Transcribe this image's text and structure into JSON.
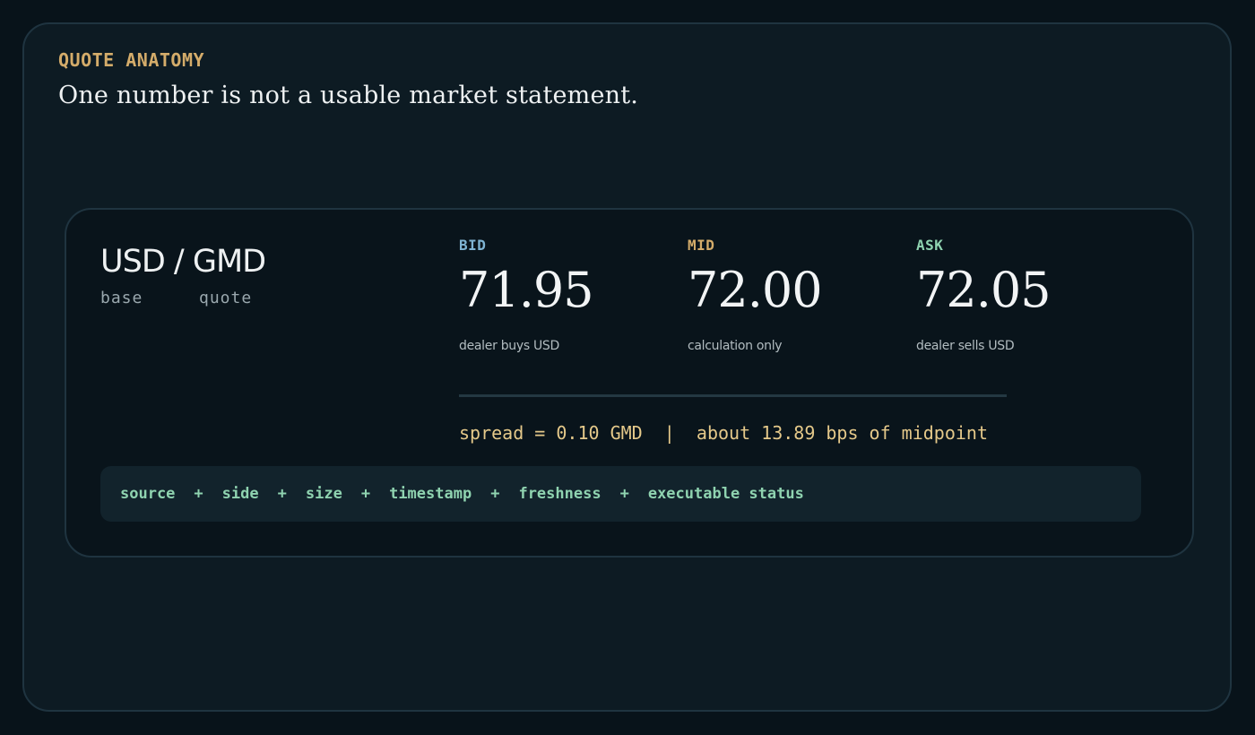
{
  "section": {
    "eyebrow": "QUOTE ANATOMY",
    "headline": "One number is not a usable market statement."
  },
  "quote": {
    "pair": "USD / GMD",
    "base_label": "base",
    "quote_label": "quote",
    "columns": [
      {
        "label": "BID",
        "value": "71.95",
        "note": "dealer buys USD",
        "color": "#7fb4d3"
      },
      {
        "label": "MID",
        "value": "72.00",
        "note": "calculation only",
        "color": "#d4ac6a"
      },
      {
        "label": "ASK",
        "value": "72.05",
        "note": "dealer sells USD",
        "color": "#8fd3b0"
      }
    ],
    "spread_text": "spread = 0.10 GMD  |  about 13.89 bps of midpoint"
  },
  "fields": {
    "items": [
      "source",
      "side",
      "size",
      "timestamp",
      "freshness",
      "executable status"
    ],
    "separator": "+"
  },
  "colors": {
    "background": "#08131a",
    "panel": "#0d1b23",
    "card": "#09141b",
    "accent_gold": "#d4ac6a",
    "accent_blue": "#7fb4d3",
    "accent_green": "#8fd3b0"
  }
}
